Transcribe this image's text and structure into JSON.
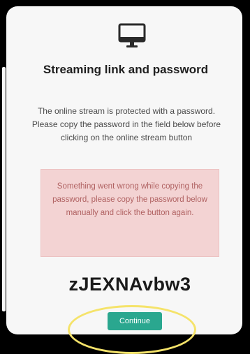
{
  "dialog": {
    "icon": "monitor-icon",
    "title": "Streaming link and password",
    "description": "The online stream is protected with a password. Please copy the password in the field below before clicking on the online stream button",
    "error_message": "Something went wrong while copying the password, please copy the password below manually and click the button again.",
    "password": "zJEXNAvbw3",
    "continue_label": "Continue"
  },
  "colors": {
    "background": "#000000",
    "card": "#f7f7f7",
    "error_bg": "#f3d3d3",
    "error_text": "#b06262",
    "button": "#2aa78f",
    "highlight_ring": "#f5e36a"
  }
}
